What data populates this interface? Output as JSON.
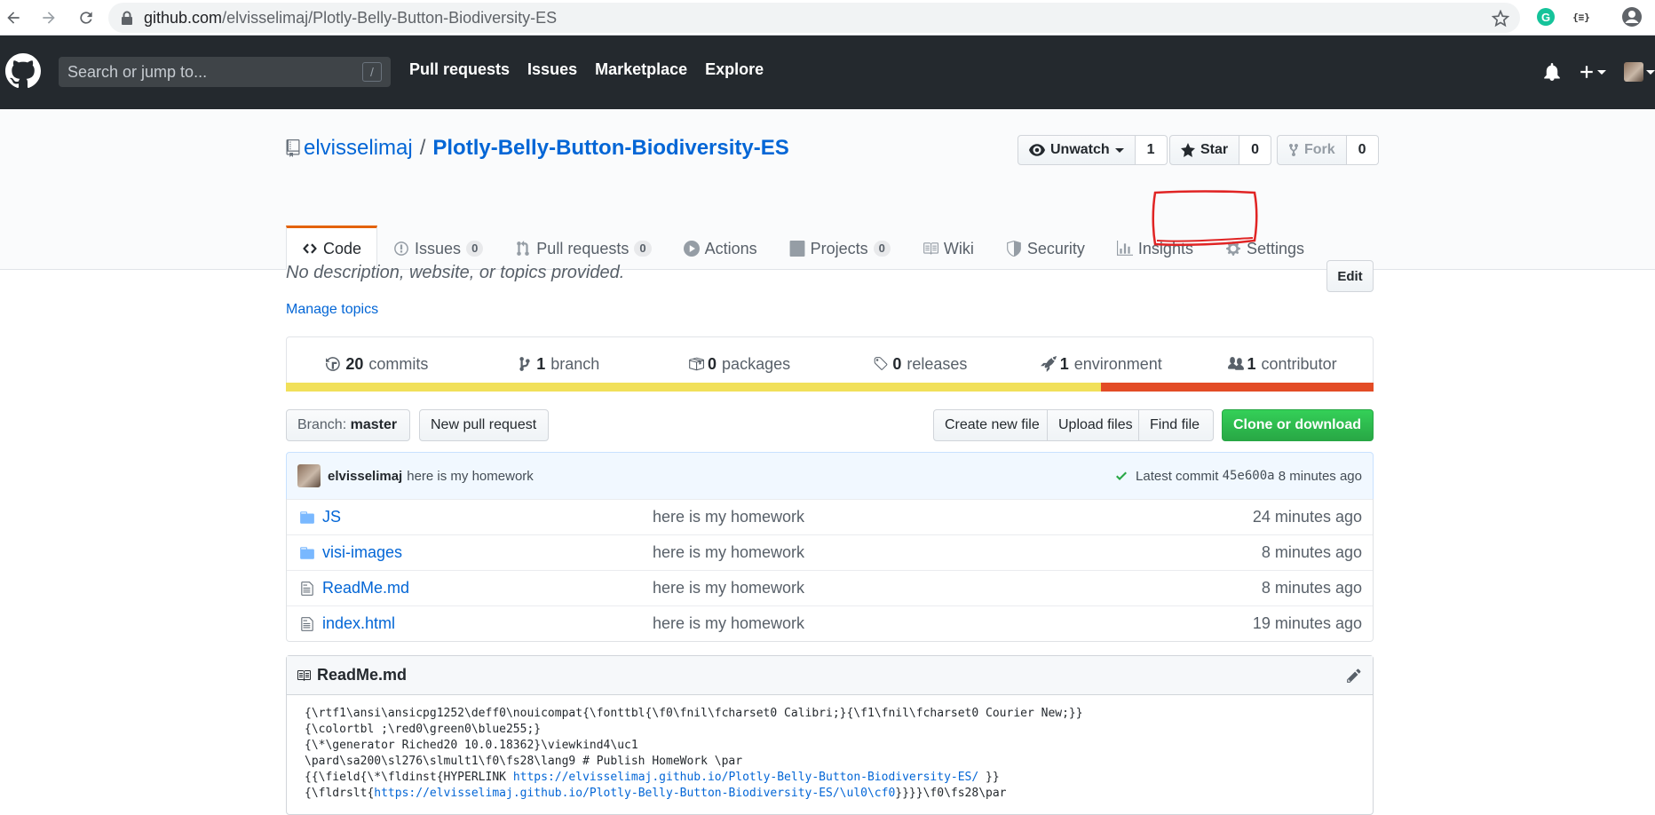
{
  "browser": {
    "url_domain": "github.com",
    "url_path": "/elvisselimaj/Plotly-Belly-Button-Biodiversity-ES"
  },
  "header": {
    "search_placeholder": "Search or jump to...",
    "search_shortcut": "/",
    "nav": [
      "Pull requests",
      "Issues",
      "Marketplace",
      "Explore"
    ]
  },
  "repo": {
    "owner": "elvisselimaj",
    "separator": "/",
    "name": "Plotly-Belly-Button-Biodiversity-ES",
    "watch_label": "Unwatch",
    "watch_count": "1",
    "star_label": "Star",
    "star_count": "0",
    "fork_label": "Fork",
    "fork_count": "0"
  },
  "tabs": [
    {
      "label": "Code",
      "count": null
    },
    {
      "label": "Issues",
      "count": "0"
    },
    {
      "label": "Pull requests",
      "count": "0"
    },
    {
      "label": "Actions",
      "count": null
    },
    {
      "label": "Projects",
      "count": "0"
    },
    {
      "label": "Wiki",
      "count": null
    },
    {
      "label": "Security",
      "count": null
    },
    {
      "label": "Insights",
      "count": null
    },
    {
      "label": "Settings",
      "count": null
    }
  ],
  "about": {
    "description": "No description, website, or topics provided.",
    "edit_label": "Edit",
    "manage_topics": "Manage topics"
  },
  "summary": [
    {
      "num": "20",
      "label": "commits"
    },
    {
      "num": "1",
      "label": "branch"
    },
    {
      "num": "0",
      "label": "packages"
    },
    {
      "num": "0",
      "label": "releases"
    },
    {
      "num": "1",
      "label": "environment"
    },
    {
      "num": "1",
      "label": "contributor"
    }
  ],
  "language_colors": {
    "primary": "#f1e05a",
    "secondary": "#e34c26"
  },
  "language_split": {
    "primary": 0.749,
    "secondary": 0.251
  },
  "file_nav": {
    "branch_prefix": "Branch:",
    "branch_name": "master",
    "new_pr": "New pull request",
    "create_file": "Create new file",
    "upload_files": "Upload files",
    "find_file": "Find file",
    "clone": "Clone or download"
  },
  "commit": {
    "author": "elvisselimaj",
    "message": "here is my homework",
    "latest_label": "Latest commit",
    "sha": "45e600a",
    "age": "8 minutes ago"
  },
  "files": [
    {
      "type": "dir",
      "name": "JS",
      "message": "here is my homework",
      "age": "24 minutes ago"
    },
    {
      "type": "dir",
      "name": "visi-images",
      "message": "here is my homework",
      "age": "8 minutes ago"
    },
    {
      "type": "file",
      "name": "ReadMe.md",
      "message": "here is my homework",
      "age": "8 minutes ago"
    },
    {
      "type": "file",
      "name": "index.html",
      "message": "here is my homework",
      "age": "19 minutes ago"
    }
  ],
  "readme": {
    "title": "ReadMe.md",
    "lines": [
      {
        "text": "{\\rtf1\\ansi\\ansicpg1252\\deff0\\nouicompat{\\fonttbl{\\f0\\fnil\\fcharset0 Calibri;}{\\f1\\fnil\\fcharset0 Courier New;}}"
      },
      {
        "text": "{\\colortbl ;\\red0\\green0\\blue255;}"
      },
      {
        "text": "{\\*\\generator Riched20 10.0.18362}\\viewkind4\\uc1"
      },
      {
        "text": "\\pard\\sa200\\sl276\\slmult1\\f0\\fs28\\lang9 # Publish HomeWork \\par"
      },
      {
        "pre": "{{\\field{\\*\\fldinst{HYPERLINK ",
        "link": "https://elvisselimaj.github.io/Plotly-Belly-Button-Biodiversity-ES/",
        "post": " }}"
      },
      {
        "pre": "{\\fldrslt{",
        "link": "https://elvisselimaj.github.io/Plotly-Belly-Button-Biodiversity-ES/\\ul0\\cf0",
        "post": "}}}}\\f0\\fs28\\par"
      }
    ]
  }
}
